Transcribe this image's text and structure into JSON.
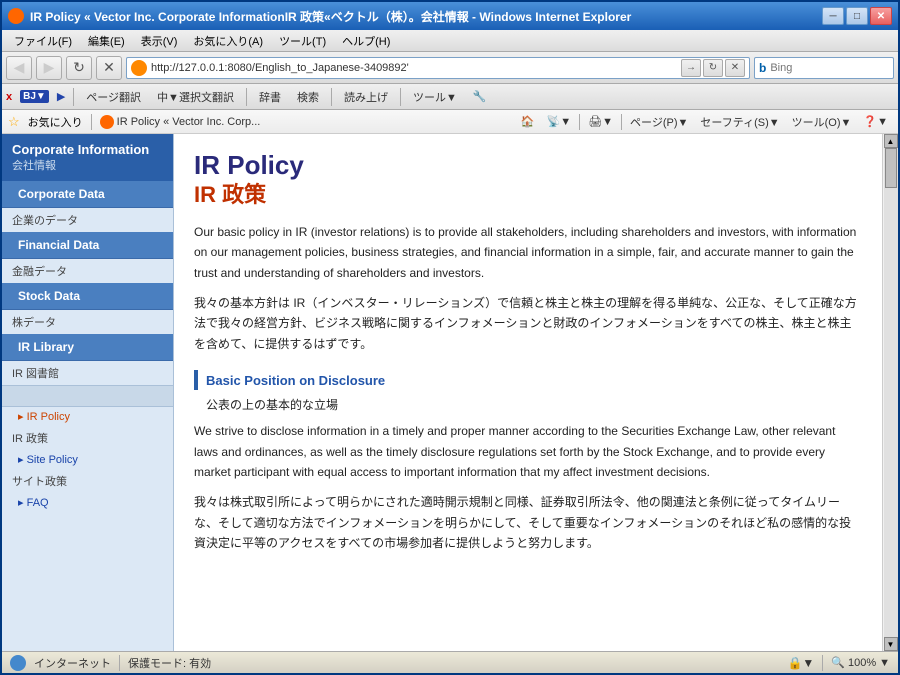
{
  "window": {
    "title": "IR Policy « Vector Inc. Corporate InformationIR 政策«ベクトル（株）。会社情報 - Windows Internet Explorer",
    "icon": "ie-icon"
  },
  "nav": {
    "back_button": "◀",
    "forward_button": "▶",
    "address": "http://127.0.0.1:8080/English_to_Japanese-3409892'",
    "refresh_label": "↻",
    "stop_label": "✕",
    "search_placeholder": "Bing",
    "go_label": "→"
  },
  "toolbar": {
    "x_label": "x",
    "lang_label": "BJ▼",
    "play_label": "▶",
    "translate_page": "ページ翻訳",
    "translate_selection": "中▼選択文翻訳",
    "dictionary": "辞書",
    "search": "検索",
    "read_aloud": "読み上げ",
    "tools": "ツール▼",
    "tools_icon": "🔧"
  },
  "bookmarks": {
    "star_label": "☆ お気に入り",
    "fav_item": "IR Policy « Vector Inc. Corp...",
    "home_label": "🏠",
    "rss_label": "📡",
    "print_label": "🖨",
    "page_label": "ページ(P)▼",
    "safety_label": "セーフティ(S)▼",
    "tools_label": "ツール(O)▼",
    "help_label": "❓▼"
  },
  "menu": {
    "file": "ファイル(F)",
    "edit": "編集(E)",
    "view": "表示(V)",
    "favorites": "お気に入り(A)",
    "tools": "ツール(T)",
    "help": "ヘルプ(H)"
  },
  "sidebar": {
    "header_en": "Corporate Information",
    "header_ja": "会社情報",
    "nav_items": [
      {
        "label_en": "Corporate Data",
        "label_ja": "企業のデータ"
      },
      {
        "label_en": "Financial Data",
        "label_ja": "金融データ"
      },
      {
        "label_en": "Stock Data",
        "label_ja": "株データ"
      },
      {
        "label_en": "IR Library",
        "label_ja": "IR 図書館"
      }
    ],
    "sub_links": [
      {
        "label": "IR Policy",
        "label_ja": "IR 政策",
        "active": true
      },
      {
        "label": "Site Policy",
        "label_ja": "サイト政策"
      },
      {
        "label": "FAQ",
        "label_ja": ""
      }
    ]
  },
  "content": {
    "title_en": "IR Policy",
    "title_ja": "IR 政策",
    "para1_en": "Our basic policy in IR (investor relations) is to provide all stakeholders, including shareholders and investors, with information on our management policies, business strategies, and financial information in a simple, fair, and accurate manner to gain the trust and understanding of shareholders and investors.",
    "para1_ja": "我々の基本方針は IR（インベスター・リレーションズ）で信頼と株主と株主の理解を得る単純な、公正な、そして正確な方法で我々の経営方針、ビジネス戦略に関するインフォメーションと財政のインフォメーションをすべての株主、株主と株主を含めて、に提供するはずです。",
    "section1_heading_en": "Basic Position on Disclosure",
    "section1_heading_ja": "公表の上の基本的な立場",
    "para2_en": "We strive to disclose information in a timely and proper manner according to the Securities Exchange Law, other relevant laws and ordinances, as well as the timely disclosure regulations set forth by the Stock Exchange, and to provide every market participant with equal access to important information that my affect investment decisions.",
    "para2_ja": "我々は株式取引所によって明らかにされた適時開示規制と同様、証券取引所法令、他の関連法と条例に従ってタイムリーな、そして適切な方法でインフォメーションを明らかにして、そして重要なインフォメーションのそれほど私の感情的な投資決定に平等のアクセスをすべての市場参加者に提供しようと努力します。"
  },
  "status": {
    "internet_label": "インターネット",
    "protection_label": "保護モード: 有効",
    "zoom_label": "100%"
  }
}
